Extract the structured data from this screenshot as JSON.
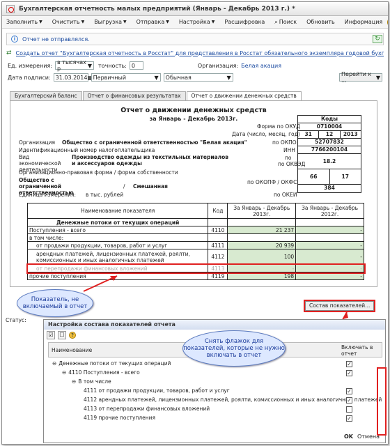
{
  "window": {
    "title": "Бухгалтерская отчетность малых предприятий (Январь - Декабрь 2013 г.) *"
  },
  "toolbar": [
    "Заполнить",
    "Очистить",
    "Выгрузка",
    "Отправка",
    "Настройка",
    "Расшифровка",
    "Поиск",
    "Обновить",
    "Информация"
  ],
  "notice": {
    "text": "Отчет не отправлялся."
  },
  "link": {
    "text": "Создать отчет \"Бухгалтерская отчетность в Росстат\" для представления в Росстат обязательного экземпляра годовой бухгалтерской отчетно..."
  },
  "fields": {
    "unit_label": "Ед. измерения:",
    "unit_value": "в тысячах р",
    "precision_label": "точность:",
    "precision_value": "0",
    "org_label": "Организация:",
    "org_value": "Белая акация",
    "sign_label": "Дата подписи:",
    "sign_value": "31.03.2014",
    "kind_value": "Первичный",
    "type_value": "Обычная",
    "goto": "Перейти к ..."
  },
  "tabs": [
    "Бухгалтерский баланс",
    "Отчет о финансовых результатах",
    "Отчет о движении денежных средств"
  ],
  "report": {
    "title": "Отчет о движении денежных средств",
    "period": "за Январь - Декабрь 2013г.",
    "codes_head": "Коды",
    "okud_label": "Форма по ОКУД",
    "okud": "0710004",
    "date_label": "Дата (число, месяц, год)",
    "d": "31",
    "m": "12",
    "y": "2013",
    "okpo_label": "по ОКПО",
    "okpo": "52707832",
    "inn_label": "ИНН",
    "inn": "7766200104",
    "okved_label": "по ОКВЭД",
    "okved": "18.2",
    "okopf_label": "по ОКОПФ / ОКФС",
    "okopf": "66",
    "okfs": "17",
    "okei_label": "по ОКЕИ",
    "okei": "384",
    "org_label": "Организация",
    "org": "Общество с ограниченной ответственностью \"Белая акация\"",
    "inn_row": "Идентификационный номер налогоплательщика",
    "activity_label": "Вид экономической деятельности",
    "activity": "Производство одежды из текстильных материалов и аксессуаров одежды",
    "opf_row": "Организационно-правовая форма / форма собственности",
    "opf": "Общество с ограниченной ответственностью",
    "fs": "Смешанная",
    "slash": "/",
    "unit_row": "Единица измерения:",
    "unit": "в тыс. рублей",
    "col_name": "Наименование показателя",
    "col_code": "Код",
    "col_2013": "За Январь - Декабрь 2013г.",
    "col_2012": "За Январь - Декабрь 2012г.",
    "rows": [
      {
        "name": "Денежные потоки от текущих операций",
        "code": "",
        "v1": "",
        "v2": "",
        "bold": true
      },
      {
        "name": "Поступления - всего",
        "code": "4110",
        "v1": "21 237",
        "v2": "-"
      },
      {
        "name": "в том числе:",
        "code": "",
        "v1": "",
        "v2": ""
      },
      {
        "name": "от продажи продукции, товаров, работ и услуг",
        "code": "4111",
        "v1": "20 939",
        "v2": "-"
      },
      {
        "name": "арендных платежей, лицензионных платежей, роялти, комиссионных и иных аналогичных платежей",
        "code": "4112",
        "v1": "100",
        "v2": "-"
      },
      {
        "name": "от перепродажи финансовых вложений",
        "code": "4113",
        "v1": "-",
        "v2": "-"
      },
      {
        "name": "прочие поступления",
        "code": "4119",
        "v1": "198",
        "v2": "-"
      }
    ]
  },
  "callout1": "Показатель, не включаемый в отчет",
  "callout2": "Снять флажок для показателей, которые не нужно включать в отчет",
  "sostav": "Состав показателей...",
  "status": "Статус:",
  "panel": {
    "title": "Настройка состава показателей отчета",
    "col_name": "Наименование",
    "col_incl": "Включать в отчет",
    "items": [
      {
        "text": "Денежные потоки от текущих операций",
        "indent": 0,
        "checked": true,
        "prefix": "⊖"
      },
      {
        "text": "4110 Поступления - всего",
        "indent": 1,
        "checked": true,
        "prefix": "⊖"
      },
      {
        "text": "В том числе",
        "indent": 2,
        "checked": null,
        "prefix": "⊖"
      },
      {
        "text": "4111 от продажи продукции, товаров, работ и услуг",
        "indent": 3,
        "checked": true,
        "prefix": ""
      },
      {
        "text": "4112 арендных платежей, лицензионных платежей, роялти, комиссионных и иных аналогичных платежей",
        "indent": 3,
        "checked": true,
        "prefix": ""
      },
      {
        "text": "4113 от перепродажи финансовых вложений",
        "indent": 3,
        "checked": false,
        "prefix": ""
      },
      {
        "text": "4119 прочие поступления",
        "indent": 3,
        "checked": true,
        "prefix": ""
      }
    ],
    "ok": "OK",
    "cancel": "Отмена"
  }
}
